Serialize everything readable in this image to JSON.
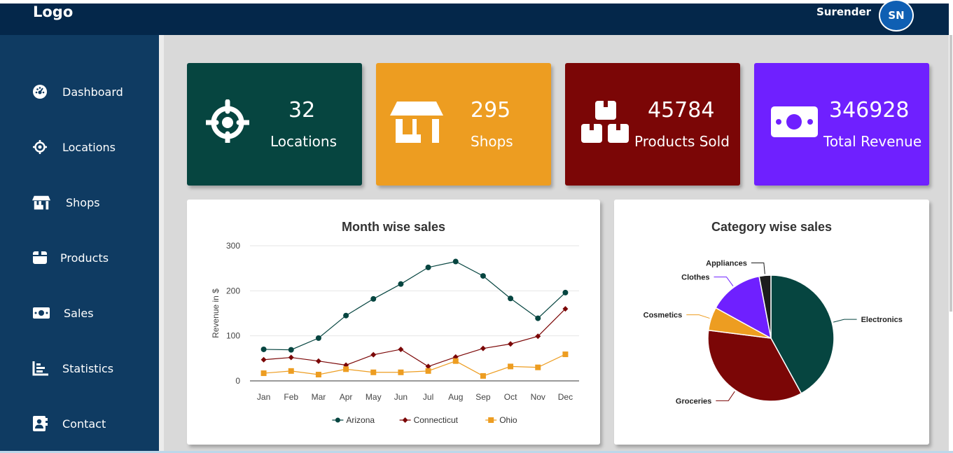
{
  "header": {
    "logo": "Logo",
    "username": "Surender",
    "avatar_initials": "SN"
  },
  "sidebar": {
    "items": [
      {
        "label": "Dashboard",
        "icon": "dashboard-icon"
      },
      {
        "label": "Locations",
        "icon": "crosshair-icon"
      },
      {
        "label": "Shops",
        "icon": "store-icon"
      },
      {
        "label": "Products",
        "icon": "box-icon"
      },
      {
        "label": "Sales",
        "icon": "money-icon"
      },
      {
        "label": "Statistics",
        "icon": "bar-chart-icon"
      },
      {
        "label": "Contact",
        "icon": "contact-icon"
      }
    ]
  },
  "cards": [
    {
      "value": "32",
      "label": "Locations",
      "color": "#064540",
      "icon": "crosshair-icon"
    },
    {
      "value": "295",
      "label": "Shops",
      "color": "#ed9d21",
      "icon": "store-icon"
    },
    {
      "value": "45784",
      "label": "Products Sold",
      "color": "#7b0606",
      "icon": "boxes-icon"
    },
    {
      "value": "346928",
      "label": "Total Revenue",
      "color": "#6f20ff",
      "icon": "money-icon"
    }
  ],
  "charts": {
    "month_title": "Month wise sales",
    "category_title": "Category wise sales"
  },
  "chart_data": [
    {
      "type": "line",
      "title": "Month wise sales",
      "xlabel": "",
      "ylabel": "Revenue in $",
      "ylim": [
        0,
        300
      ],
      "yticks": [
        0,
        100,
        200,
        300
      ],
      "grid": true,
      "legend": "bottom",
      "categories": [
        "Jan",
        "Feb",
        "Mar",
        "Apr",
        "May",
        "Jun",
        "Jul",
        "Aug",
        "Sep",
        "Oct",
        "Nov",
        "Dec"
      ],
      "series": [
        {
          "name": "Arizona",
          "color": "#064540",
          "marker": "circle",
          "values": [
            70,
            69,
            95,
            145,
            182,
            215,
            252,
            265,
            233,
            183,
            139,
            196
          ]
        },
        {
          "name": "Connecticut",
          "color": "#7b0606",
          "marker": "diamond",
          "values": [
            47,
            52,
            44,
            35,
            58,
            70,
            32,
            53,
            72,
            82,
            99,
            160
          ]
        },
        {
          "name": "Ohio",
          "color": "#ed9d21",
          "marker": "square",
          "values": [
            17,
            22,
            14,
            26,
            19,
            19,
            22,
            44,
            11,
            32,
            30,
            59
          ]
        }
      ]
    },
    {
      "type": "pie",
      "title": "Category wise sales",
      "slices": [
        {
          "label": "Electronics",
          "value": 42,
          "color": "#064540"
        },
        {
          "label": "Groceries",
          "value": 35,
          "color": "#7b0606"
        },
        {
          "label": "Cosmetics",
          "value": 6,
          "color": "#ed9d21"
        },
        {
          "label": "Clothes",
          "value": 14,
          "color": "#6f20ff"
        },
        {
          "label": "Appliances",
          "value": 3,
          "color": "#1c1c1c"
        }
      ]
    }
  ]
}
